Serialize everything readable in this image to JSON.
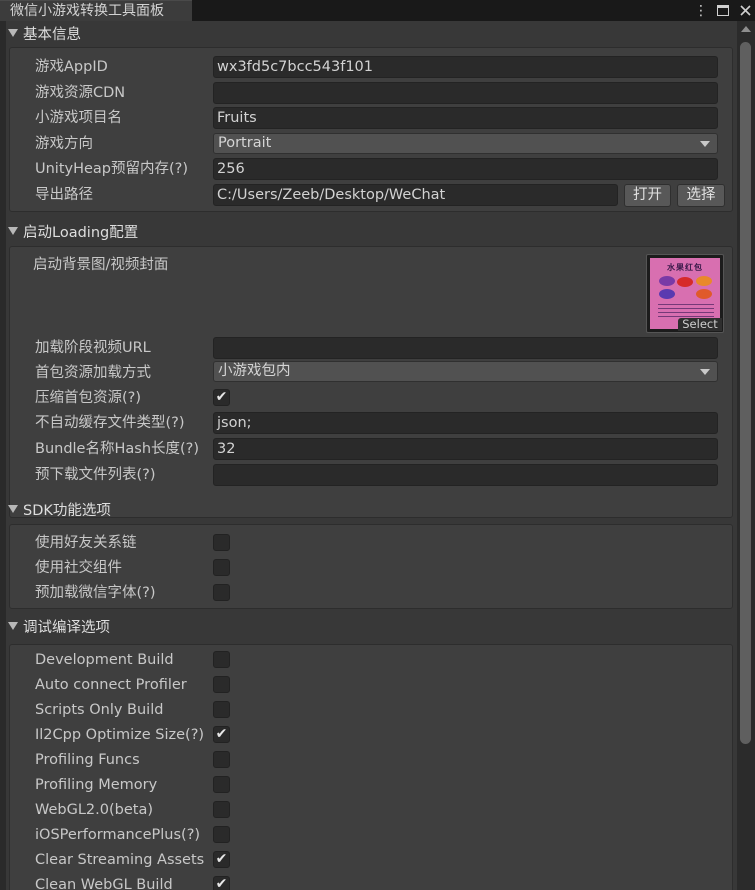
{
  "window": {
    "tab_title": "微信小游戏转换工具面板"
  },
  "sections": {
    "basic": {
      "title": "基本信息",
      "app_id_label": "游戏AppID",
      "app_id_value": "wx3fd5c7bcc543f101",
      "cdn_label": "游戏资源CDN",
      "cdn_value": "",
      "project_name_label": "小游戏项目名",
      "project_name_value": "Fruits",
      "orientation_label": "游戏方向",
      "orientation_value": "Portrait",
      "heap_label": "UnityHeap预留内存(?)",
      "heap_value": "256",
      "export_path_label": "导出路径",
      "export_path_value": "C:/Users/Zeeb/Desktop/WeChat",
      "open_button": "打开",
      "choose_button": "选择"
    },
    "loading": {
      "title": "启动Loading配置",
      "bg_label": "启动背景图/视频封面",
      "thumbnail_title": "水果红包",
      "thumbnail_select": "Select",
      "video_url_label": "加载阶段视频URL",
      "video_url_value": "",
      "load_mode_label": "首包资源加载方式",
      "load_mode_value": "小游戏包内",
      "compress_label": "压缩首包资源(?)",
      "compress_checked": true,
      "no_cache_label": "不自动缓存文件类型(?)",
      "no_cache_value": "json;",
      "hash_len_label": "Bundle名称Hash长度(?)",
      "hash_len_value": "32",
      "preload_label": "预下载文件列表(?)",
      "preload_value": ""
    },
    "sdk": {
      "title": "SDK功能选项",
      "items": [
        {
          "label": "使用好友关系链",
          "checked": false
        },
        {
          "label": "使用社交组件",
          "checked": false
        },
        {
          "label": "预加载微信字体(?)",
          "checked": false
        }
      ]
    },
    "debug": {
      "title": "调试编译选项",
      "items": [
        {
          "label": "Development Build",
          "checked": false
        },
        {
          "label": "Auto connect Profiler",
          "checked": false
        },
        {
          "label": "Scripts Only Build",
          "checked": false
        },
        {
          "label": "Il2Cpp Optimize Size(?)",
          "checked": true
        },
        {
          "label": "Profiling Funcs",
          "checked": false
        },
        {
          "label": "Profiling Memory",
          "checked": false
        },
        {
          "label": "WebGL2.0(beta)",
          "checked": false
        },
        {
          "label": "iOSPerformancePlus(?)",
          "checked": false
        },
        {
          "label": "Clear Streaming Assets",
          "checked": true
        },
        {
          "label": "Clean WebGL Build",
          "checked": true
        }
      ]
    }
  },
  "icons": {
    "checkmark": "✔",
    "kebab": "⋮"
  },
  "colors": {
    "panel_bg": "#383838",
    "box_bg": "#3f3f3f",
    "field_bg": "#2a2a2a",
    "thumbnail_pink": "#d86fb0"
  }
}
